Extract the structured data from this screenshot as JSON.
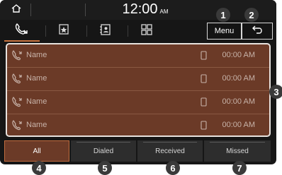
{
  "status_bar": {
    "time": "12:00",
    "ampm": "AM"
  },
  "tabs": [
    {
      "icon": "call-history-icon",
      "active": true
    },
    {
      "icon": "favorites-icon",
      "active": false
    },
    {
      "icon": "contacts-icon",
      "active": false
    },
    {
      "icon": "keypad-icon",
      "active": false
    }
  ],
  "header": {
    "menu_label": "Menu",
    "back_icon": "back-arrow-icon"
  },
  "calls": [
    {
      "name": "Name",
      "time": "00:00 AM",
      "icon": "call-log-icon",
      "device_icon": "phone-device-icon"
    },
    {
      "name": "Name",
      "time": "00:00 AM",
      "icon": "call-log-icon",
      "device_icon": "phone-device-icon"
    },
    {
      "name": "Name",
      "time": "00:00 AM",
      "icon": "call-log-icon",
      "device_icon": "phone-device-icon"
    },
    {
      "name": "Name",
      "time": "00:00 AM",
      "icon": "call-log-icon",
      "device_icon": "phone-device-icon"
    }
  ],
  "filters": [
    {
      "label": "All",
      "active": true
    },
    {
      "label": "Dialed",
      "active": false
    },
    {
      "label": "Received",
      "active": false
    },
    {
      "label": "Missed",
      "active": false
    }
  ],
  "callouts": [
    "1",
    "2",
    "3",
    "4",
    "5",
    "6",
    "7"
  ],
  "colors": {
    "accent": "#c9733f",
    "list_background": "#6b3a27",
    "screen_background": "#161616",
    "text_muted": "#c7b2a8"
  }
}
